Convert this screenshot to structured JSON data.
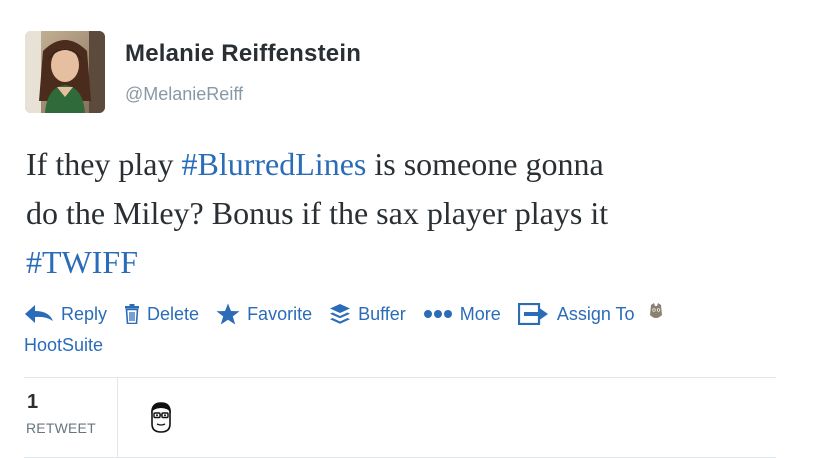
{
  "author": {
    "name": "Melanie Reiffenstein",
    "handle": "@MelanieReiff"
  },
  "tweet": {
    "line1_pre": "If they play ",
    "line1_hashtag": "#BlurredLines",
    "line1_post": " is someone gonna",
    "line2": "do the Miley? Bonus if the sax player plays it",
    "line3_hashtag": "#TWIFF"
  },
  "actions": {
    "reply": "Reply",
    "delete": "Delete",
    "favorite": "Favorite",
    "buffer": "Buffer",
    "more": "More",
    "assign_to": "Assign To",
    "hootsuite": "HootSuite"
  },
  "stats": {
    "retweet_count": "1",
    "retweet_label": "RETWEET"
  },
  "colors": {
    "link": "#2b6cb8",
    "text": "#292f33",
    "muted": "#8899a6",
    "divider": "#e1e8ed"
  },
  "icons": {
    "reply": "reply-arrow-icon",
    "delete": "trash-icon",
    "favorite": "star-icon",
    "buffer": "buffer-layers-icon",
    "more": "ellipsis-icon",
    "assign": "assign-arrow-icon",
    "hootsuite": "hootsuite-owl-icon"
  }
}
